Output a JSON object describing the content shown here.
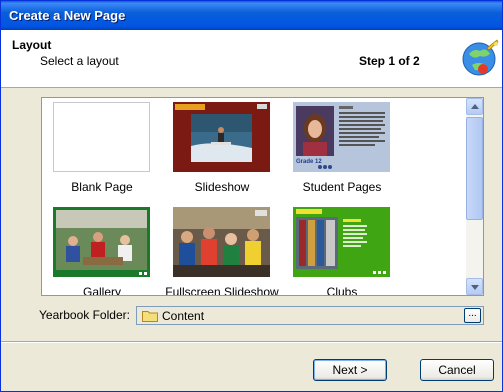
{
  "window": {
    "title": "Create a New Page"
  },
  "header": {
    "title": "Layout",
    "subtitle": "Select a layout",
    "step": "Step 1 of 2"
  },
  "layouts": [
    {
      "label": "Blank Page"
    },
    {
      "label": "Slideshow"
    },
    {
      "label": "Student Pages"
    },
    {
      "label": "Gallery"
    },
    {
      "label": "Fullscreen Slideshow"
    },
    {
      "label": "Clubs"
    }
  ],
  "thumb_text": {
    "grade": "Grade 12"
  },
  "folder": {
    "label": "Yearbook Folder:",
    "value": "Content",
    "browse": "..."
  },
  "buttons": {
    "next": "Next >",
    "cancel": "Cancel"
  },
  "colors": {
    "title_bar": "#0054e3",
    "dialog_bg": "#ece9d8",
    "slideshow_frame": "#7b1a12",
    "clubs_bg": "#3fa512",
    "gallery_frame": "#1a7a2a"
  }
}
